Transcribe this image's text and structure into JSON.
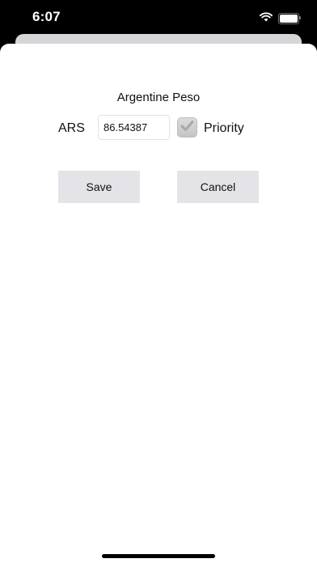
{
  "status_bar": {
    "time": "6:07",
    "icons": [
      "wifi-icon",
      "battery-icon"
    ]
  },
  "form": {
    "currency_name": "Argentine Peso",
    "currency_code": "ARS",
    "rate_value": "86.54387",
    "priority_label": "Priority",
    "priority_checked": true
  },
  "buttons": {
    "save_label": "Save",
    "cancel_label": "Cancel"
  },
  "colors": {
    "status_bar_bg": "#000000",
    "sheet_bg": "#ffffff",
    "button_bg": "#e4e4e8",
    "checkbox_bg": "#cfcfcf"
  }
}
